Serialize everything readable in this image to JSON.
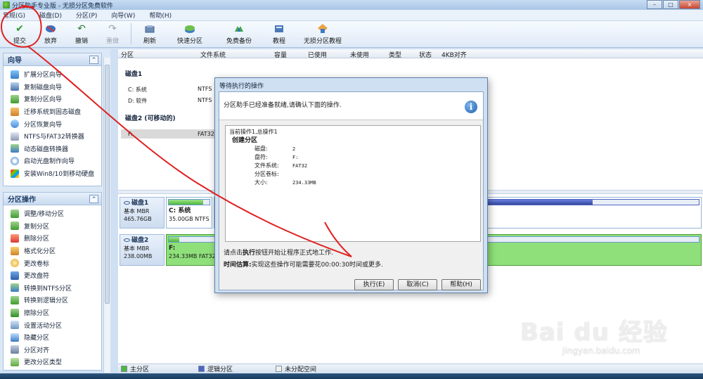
{
  "window": {
    "title": "分区助手专业版 - 无损分区免费软件",
    "min": "–",
    "max": "□",
    "close": "×"
  },
  "menu": [
    "常规(G)",
    "磁盘(D)",
    "分区(P)",
    "向导(W)",
    "帮助(H)"
  ],
  "toolbar": {
    "items": [
      {
        "label": "提交",
        "icon": "check-icon"
      },
      {
        "label": "放弃",
        "icon": "discard-icon"
      },
      {
        "label": "撤销",
        "icon": "undo-icon"
      },
      {
        "label": "重做",
        "icon": "redo-icon"
      },
      {
        "label": "刷新",
        "icon": "refresh-icon"
      },
      {
        "label": "快速分区",
        "icon": "quick-partition-icon"
      },
      {
        "label": "免费备份",
        "icon": "backup-icon"
      },
      {
        "label": "教程",
        "icon": "tutorial-icon"
      },
      {
        "label": "无损分区教程",
        "icon": "tutorial-icon"
      }
    ]
  },
  "sidebar": {
    "wizard_title": "向导",
    "wizard_items": [
      "扩展分区向导",
      "复制磁盘向导",
      "复制分区向导",
      "迁移系统到固态磁盘",
      "分区恢复向导",
      "NTFS与FAT32转换器",
      "动态磁盘转换器",
      "启动光盘制作向导",
      "安装Win8/10到移动硬盘"
    ],
    "ops_title": "分区操作",
    "ops_items": [
      "调整/移动分区",
      "复制分区",
      "删除分区",
      "格式化分区",
      "更改卷标",
      "更改盘符",
      "转换到NTFS分区",
      "转换到逻辑分区",
      "擦除分区",
      "设置活动分区",
      "隐藏分区",
      "分区对齐",
      "更改分区类型"
    ],
    "collapse": "^"
  },
  "table": {
    "headers": [
      "分区",
      "文件系统",
      "容量",
      "已使用",
      "未使用",
      "类型",
      "状态",
      "4KB对齐"
    ],
    "disk1": "磁盘1",
    "disk1_rows": [
      {
        "name": "C: 系统",
        "fs": "NTFS"
      },
      {
        "name": "D: 软件",
        "fs": "NTFS"
      }
    ],
    "disk2": "磁盘2 (可移动的)",
    "disk2_rows": [
      {
        "name": "F:",
        "fs": "FAT32"
      }
    ]
  },
  "diskmap": [
    {
      "name": "磁盘1",
      "kind": "基本 MBR",
      "size": "465.76GB",
      "part_name": "C: 系统",
      "part_info": "35.00GB NTFS",
      "used": 0.85
    },
    {
      "name": "磁盘2",
      "kind": "基本 MBR",
      "size": "238.00MB",
      "part_name": "F:",
      "part_info": "234.33MB FAT32",
      "used": 0.02
    }
  ],
  "legend": [
    {
      "label": "主分区",
      "color": "#4fb73b"
    },
    {
      "label": "逻辑分区",
      "color": "#4f64c2"
    },
    {
      "label": "未分配空间",
      "color": "#f2efe3"
    }
  ],
  "dialog": {
    "title": "等待执行的操作",
    "header": "分区助手已经准备就绪,请确认下面的操作.",
    "current": "当前操作1,总操作1",
    "op_name": "创建分区",
    "fields": [
      {
        "k": "磁盘:",
        "v": "2"
      },
      {
        "k": "盘符:",
        "v": "F:"
      },
      {
        "k": "文件系统:",
        "v": "FAT32"
      },
      {
        "k": "分区卷标:",
        "v": ""
      },
      {
        "k": "大小:",
        "v": "234.33MB"
      }
    ],
    "note_pre": "请点击",
    "note_bold": "执行",
    "note_post": "按钮开始让程序正式地工作.",
    "time_label": "时间估算:",
    "time_text": "实现这些操作可能需要花00:00:30时间或更多.",
    "buttons": {
      "execute": "执行(E)",
      "cancel": "取消(C)",
      "help": "帮助(H)"
    }
  },
  "watermark": {
    "brand": "Bai du 经验",
    "url": "jingyan.baidu.com"
  },
  "colors": {
    "accent": "#4fb73b",
    "annotation": "#e02020"
  }
}
